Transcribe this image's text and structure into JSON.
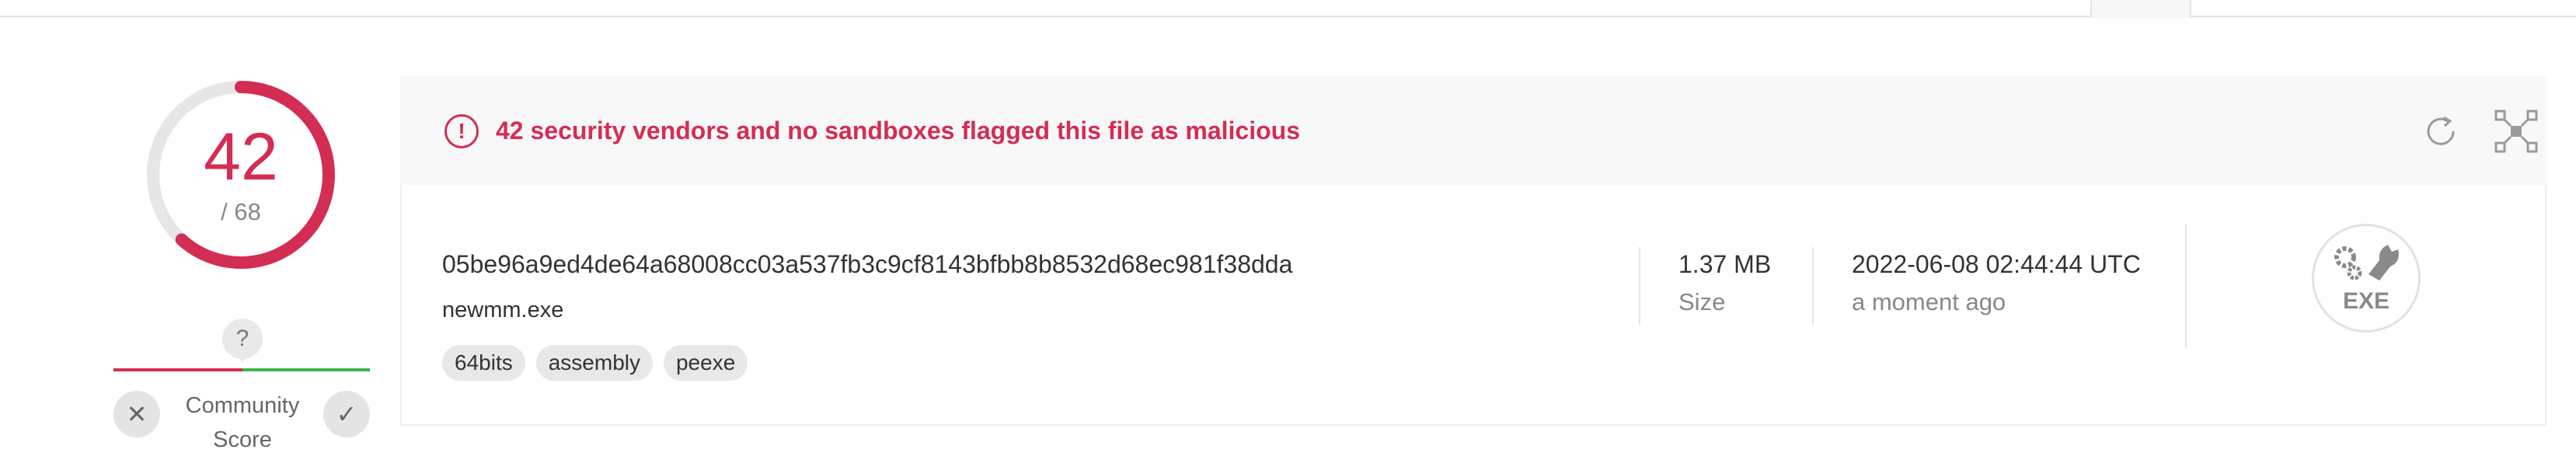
{
  "detection": {
    "score": "42",
    "total": "/ 68",
    "ratio": 0.6176,
    "color": "#d42d54"
  },
  "community": {
    "question": "?",
    "label": "Community Score",
    "label_line1": "Community",
    "label_line2": "Score",
    "downvote_glyph": "✕",
    "upvote_glyph": "✓",
    "downvote_icon": "close-icon",
    "upvote_icon": "check-icon"
  },
  "banner": {
    "alert_glyph": "!",
    "alert_icon": "alert-circle-icon",
    "message": "42 security vendors and no sandboxes flagged this file as malicious",
    "reanalyze_icon": "refresh-icon",
    "graph_icon": "graph-icon"
  },
  "file": {
    "hash": "05be96a9ed4de64a68008cc03a537fb3c9cf8143bfbb8b8532d68ec981f38dda",
    "name": "newmm.exe",
    "tags": [
      "64bits",
      "assembly",
      "peexe"
    ],
    "size": "1.37 MB",
    "size_label": "Size",
    "date": "2022-06-08 02:44:44 UTC",
    "date_label": "a moment ago",
    "type_label": "EXE",
    "type_icon": "exe-file-icon"
  }
}
